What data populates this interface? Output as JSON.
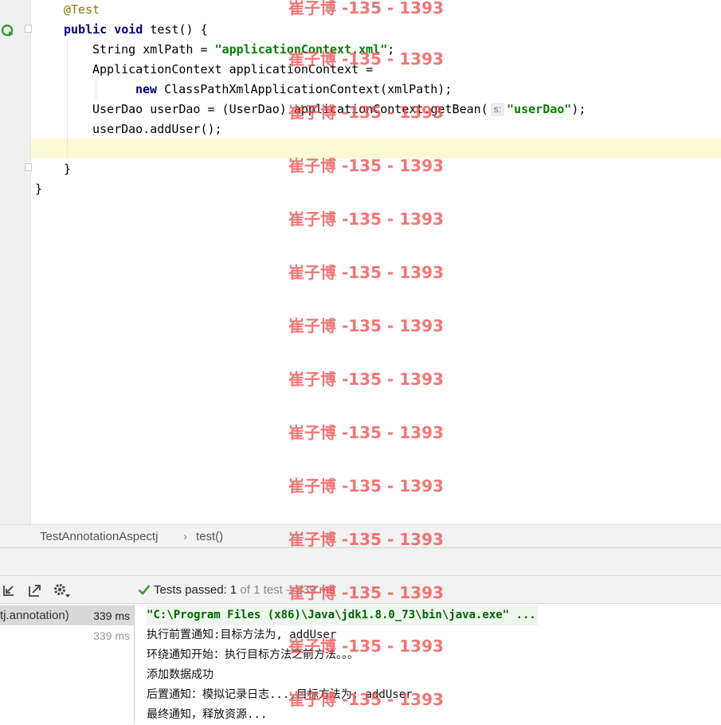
{
  "editor": {
    "lines": {
      "l1": "@Test",
      "l2_kw": "public void",
      "l2_rest": " test() {",
      "l3_a": "String xmlPath = ",
      "l3_str": "\"applicationContext.xml\"",
      "l3_b": ";",
      "l4": "ApplicationContext applicationContext =",
      "l5_kw": "new",
      "l5_rest": " ClassPathXmlApplicationContext(xmlPath);",
      "l6_a": "UserDao userDao = (UserDao) applicationContext.getBean(",
      "l6_hint": "s:",
      "l6_str": "\"userDao\"",
      "l6_b": ");",
      "l7": "userDao.addUser();",
      "l9": "}",
      "l10": "}"
    }
  },
  "breadcrumb": {
    "class_name": "TestAnnotationAspectj",
    "separator": "›",
    "method": "test()"
  },
  "test_toolbar": {
    "status_prefix": "Tests passed: ",
    "passed": "1",
    "status_of": " of 1 test",
    "status_dash": " – ",
    "duration": "339 ms"
  },
  "tree": {
    "rows": [
      {
        "name": "tj.annotation)",
        "time": "339 ms"
      },
      {
        "name": "",
        "time": "339 ms"
      }
    ]
  },
  "console": {
    "lines": [
      "\"C:\\Program Files (x86)\\Java\\jdk1.8.0_73\\bin\\java.exe\" ...",
      "执行前置通知:目标方法为, addUser",
      "环绕通知开始：执行目标方法之前方法。。。",
      "添加数据成功",
      "后置通知：模拟记录日志...,目标方法为: addUser",
      "最终通知，释放资源..."
    ]
  },
  "watermark": {
    "text": "崔子博 -135 - 1393"
  },
  "colors": {
    "keyword": "#000080",
    "string": "#008000",
    "annotation": "#808000",
    "current_line": "#fcfad6",
    "watermark": "#ed5050",
    "pass_check": "#3a9b3a"
  }
}
